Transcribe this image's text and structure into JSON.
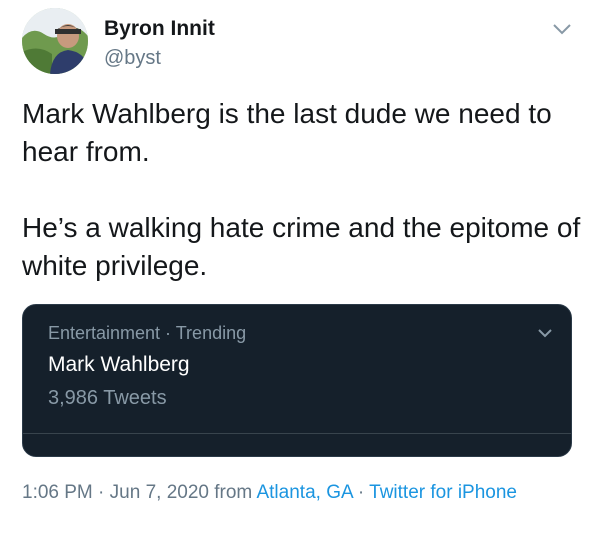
{
  "user": {
    "name": "Byron Innit",
    "handle": "@byst",
    "avatar_icon": "profile-photo"
  },
  "tweet": {
    "paragraph1": "Mark Wahlberg is the last dude we need to hear from.",
    "paragraph2": "He’s a walking hate crime and the epitome of white privilege."
  },
  "trend_card": {
    "category": "Entertainment · Trending",
    "topic": "Mark Wahlberg",
    "count": "3,986 Tweets"
  },
  "meta": {
    "time": "1:06 PM",
    "sep1": " · ",
    "date": "Jun 7, 2020",
    "from": " from ",
    "location": "Atlanta, GA",
    "sep2": " · ",
    "source": "Twitter for iPhone"
  },
  "colors": {
    "link": "#1b95e0",
    "card_bg": "#15202b",
    "secondary_text": "#657786"
  }
}
